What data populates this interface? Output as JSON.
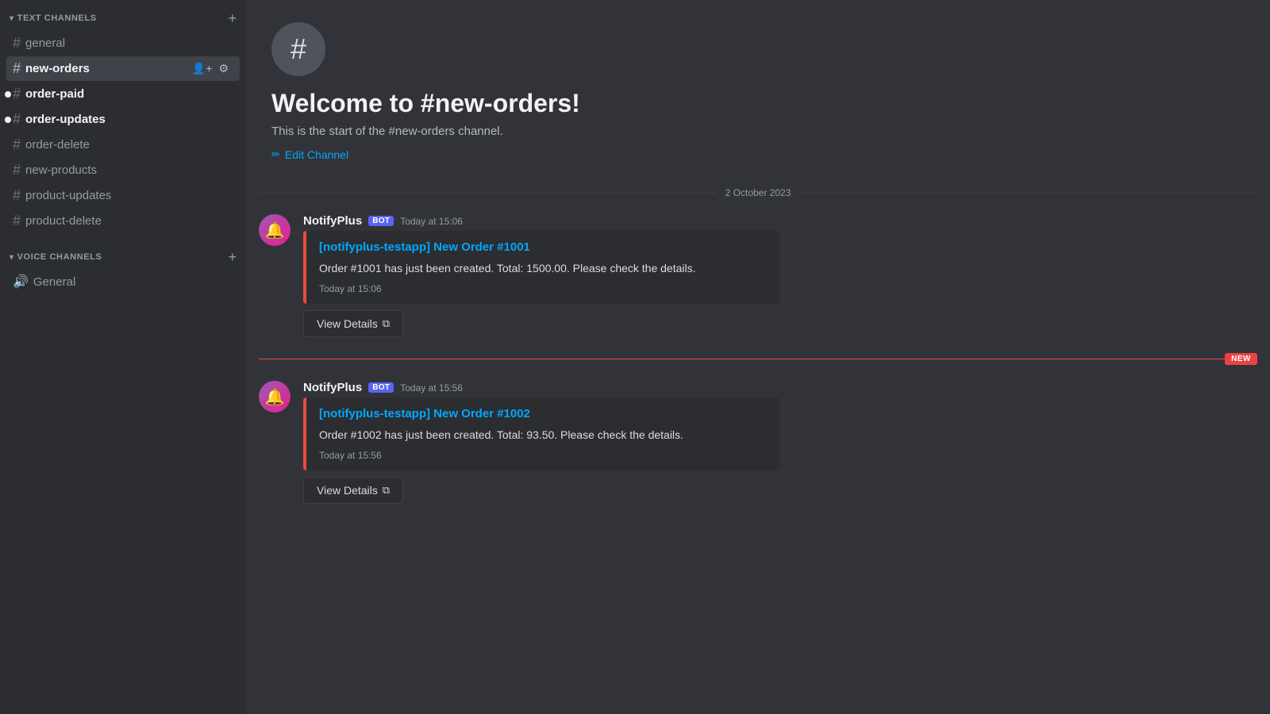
{
  "sidebar": {
    "text_channels_label": "TEXT CHANNELS",
    "voice_channels_label": "VOICE CHANNELS",
    "text_channels": [
      {
        "id": "general",
        "label": "general",
        "active": false,
        "bold": false,
        "unread": false
      },
      {
        "id": "new-orders",
        "label": "new-orders",
        "active": true,
        "bold": false,
        "unread": false
      },
      {
        "id": "order-paid",
        "label": "order-paid",
        "active": false,
        "bold": true,
        "unread": true
      },
      {
        "id": "order-updates",
        "label": "order-updates",
        "active": false,
        "bold": true,
        "unread": true
      },
      {
        "id": "order-delete",
        "label": "order-delete",
        "active": false,
        "bold": false,
        "unread": false
      },
      {
        "id": "new-products",
        "label": "new-products",
        "active": false,
        "bold": false,
        "unread": false
      },
      {
        "id": "product-updates",
        "label": "product-updates",
        "active": false,
        "bold": false,
        "unread": false
      },
      {
        "id": "product-delete",
        "label": "product-delete",
        "active": false,
        "bold": false,
        "unread": false
      }
    ],
    "voice_channels": [
      {
        "id": "general-voice",
        "label": "General"
      }
    ]
  },
  "main": {
    "channel_name": "#new-orders",
    "welcome_title": "Welcome to #new-orders!",
    "welcome_desc": "This is the start of the #new-orders channel.",
    "edit_channel_label": "Edit Channel",
    "date_divider": "2 October 2023",
    "messages": [
      {
        "id": "msg1",
        "username": "NotifyPlus",
        "bot_badge": "BOT",
        "timestamp": "Today at 15:06",
        "embed_title": "[notifyplus-testapp] New Order #1001",
        "embed_description": "Order #1001 has just been created. Total: 1500.00. Please check the details.",
        "embed_footer": "Today at 15:06",
        "view_details_label": "View Details",
        "is_new": false
      },
      {
        "id": "msg2",
        "username": "NotifyPlus",
        "bot_badge": "BOT",
        "timestamp": "Today at 15:56",
        "embed_title": "[notifyplus-testapp] New Order #1002",
        "embed_description": "Order #1002 has just been created. Total: 93.50. Please check the details.",
        "embed_footer": "Today at 15:56",
        "view_details_label": "View Details",
        "is_new": true
      }
    ]
  },
  "icons": {
    "hash": "#",
    "chevron_down": "▾",
    "plus": "+",
    "speaker": "🔊",
    "bell_icon": "🔔",
    "add_member": "👤+",
    "settings": "⚙",
    "pencil": "✏",
    "external_link": "⧉",
    "new_label": "NEW"
  }
}
